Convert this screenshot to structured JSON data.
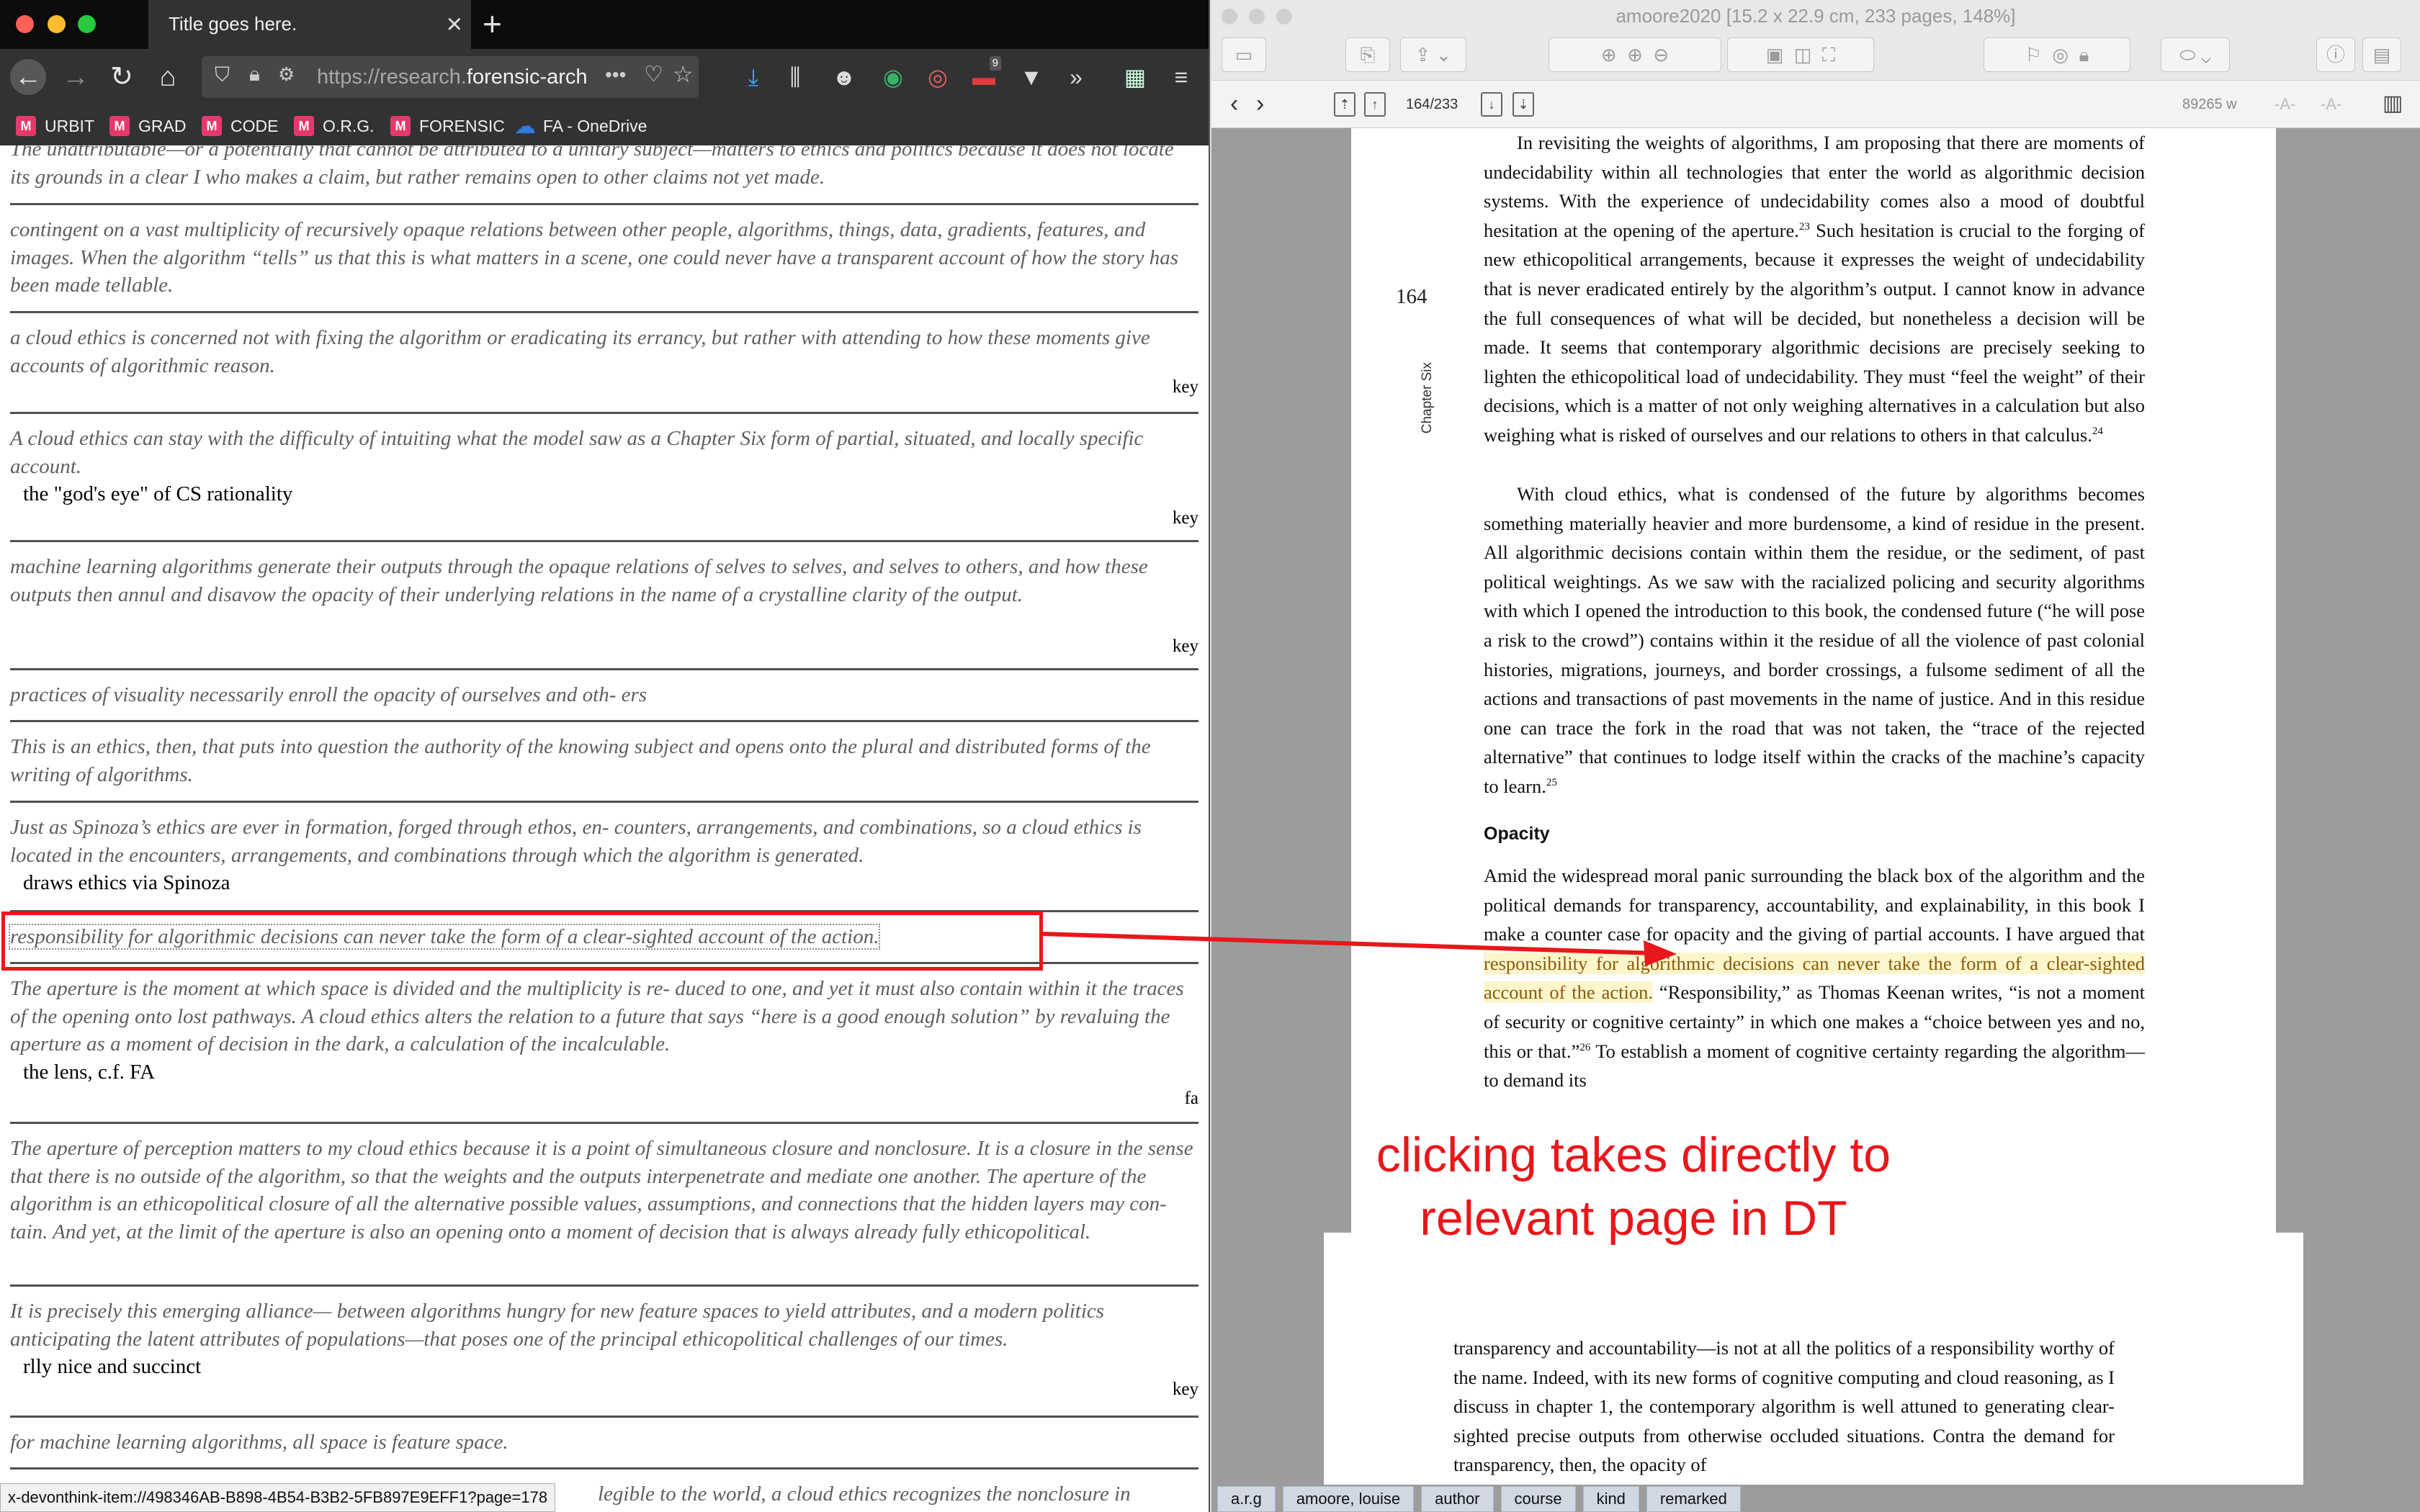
{
  "browser": {
    "tab_title": "Title goes here.",
    "url_prefix": "https://research.",
    "url_domain": "forensic-arch",
    "extensions_badge": "9",
    "bookmarks": [
      {
        "label": "URBIT"
      },
      {
        "label": "GRAD"
      },
      {
        "label": "CODE"
      },
      {
        "label": "O.R.G."
      },
      {
        "label": "FORENSIC"
      },
      {
        "label": "FA - OneDrive"
      }
    ],
    "entries": [
      {
        "quote": "The unattributable—or a potentially that cannot be attributed to a unitary subject—matters to ethics and politics because it does not locate its grounds in a clear I who makes a claim, but rather remains open to other claims not yet made.",
        "note": "",
        "tag": ""
      },
      {
        "quote": "contingent on a vast multiplicity of recursively opaque relations between other people, algorithms, things, data, gradients, features, and images. When the algorithm “tells” us that this is what matters in a scene, one could never have a transparent account of how the story has been made tellable.",
        "note": "",
        "tag": ""
      },
      {
        "quote": "a cloud ethics is concerned not with fixing the algorithm or eradicating its errancy, but rather with attending to how these moments give accounts of algorithmic reason.",
        "note": "",
        "tag": "key"
      },
      {
        "quote": "A cloud ethics can stay with the difficulty of intuiting what the model saw as a Chapter Six form of partial, situated, and locally specific account.",
        "note": "the \"god's eye\" of CS rationality",
        "tag": "key"
      },
      {
        "quote": "machine learning algorithms generate their outputs through the opaque relations of selves to selves, and selves to others, and how these outputs then annul and disavow the opacity of their underlying relations in the name of a crystalline clarity of the output.",
        "note": "",
        "tag": "key"
      },
      {
        "quote": "practices of visuality necessarily enroll the opacity of ourselves and oth- ers",
        "note": "",
        "tag": ""
      },
      {
        "quote": "This is an ethics, then, that puts into question the authority of the knowing subject and opens onto the plural and distributed forms of the writing of algorithms.",
        "note": "",
        "tag": ""
      },
      {
        "quote": "Just as Spinoza’s ethics are ever in formation, forged through ethos, en- counters, arrangements, and combinations, so a cloud ethics is located in the encounters, arrangements, and combinations through which the algorithm is generated.",
        "note": "draws ethics via Spinoza",
        "tag": ""
      },
      {
        "quote": "responsibility for algorithmic decisions can never take the form of a clear-sighted account of the action.",
        "note": "",
        "tag": ""
      },
      {
        "quote": "The aperture is the moment at which space is divided and the multiplicity is re- duced to one, and yet it must also contain within it the traces of the opening onto lost pathways. A cloud ethics alters the relation to a future that says “here is a good enough solution” by revaluing the aperture as a moment of decision in the dark, a calculation of the incalculable.",
        "note": "the lens, c.f. FA",
        "tag": "fa"
      },
      {
        "quote": "The aperture of perception matters to my cloud ethics because it is a point of simultaneous closure and nonclosure. It is a closure in the sense that there is no outside of the algorithm, so that the weights and the outputs interpenetrate and mediate one another. The aperture of the algorithm is an ethicopolitical closure of all the alternative possible values, assumptions, and connections that the hidden layers may con- tain. And yet, at the limit of the aperture is also an opening onto a moment of decision that is always already fully ethicopolitical.",
        "note": "",
        "tag": ""
      },
      {
        "quote": "It is precisely this emerging alliance— between algorithms hungry for new feature spaces to yield attributes, and a modern politics anticipating the latent attributes of populations—that poses one of the principal ethicopolitical challenges of our times.",
        "note": "rlly nice and succinct",
        "tag": "key"
      },
      {
        "quote": "for machine learning algorithms, all space is feature space.",
        "note": "",
        "tag": ""
      },
      {
        "quote": "legible to the world, a cloud ethics recognizes the nonclosure in",
        "note": "",
        "tag": ""
      }
    ],
    "status_url": "x-devonthink-item://498346AB-B898-4B54-B3B2-5FB897E9EFF1?page=178"
  },
  "pdf": {
    "window_title": "amoore2020 [15.2 x 22.9 cm, 233 pages, 148%]",
    "page_indicator": "164/233",
    "word_count": "89265 w",
    "page_number": "164",
    "chapter_label": "Chapter Six",
    "para1": "In revisiting the weights of algorithms, I am proposing that there are moments of undecidability within all technologies that enter the world as algorithmic decision systems. With the experience of undecidability comes also a mood of doubtful hesitation at the opening of the aperture.",
    "para1_fn": "23",
    "para1b": " Such hesitation is crucial to the forging of new ethicopolitical arrangements, because it expresses the weight of undecidability that is never eradicated entirely by the algorithm’s output. I cannot know in advance the full consequences of what will be decided, but nonetheless a decision will be made. It seems that contemporary algorithmic decisions are precisely seeking to lighten the ethicopolitical load of undecidability. They must “feel the weight” of their decisions, which is a matter of not only weighing alternatives in a calculation but also weighing what is risked of ourselves and our relations to others in that calculus.",
    "para1b_fn": "24",
    "para2": "With cloud ethics, what is condensed of the future by algorithms becomes something materially heavier and more burdensome, a kind of residue in the present. All algorithmic decisions contain within them the residue, or the sediment, of past political weightings. As we saw with the racialized policing and security algorithms with which I opened the introduction to this book, the condensed future (“he will pose a risk to the crowd”) contains within it the residue of all the violence of past colonial histories, migrations, journeys, and border crossings, a fulsome sediment of all the actions and transactions of past movements in the name of justice. And in this residue one can trace the fork in the road that was not taken, the “trace of the rejected alternative” that continues to lodge itself within the cracks of the machine’s capacity to learn.",
    "para2_fn": "25",
    "heading": "Opacity",
    "para3a": "Amid the widespread moral panic surrounding the black box of the algorithm and the political demands for transparency, accountability, and explainability, in this book I make a counter case for opacity and the giving of partial accounts. I have argued that ",
    "para3_hl": "responsibility for algorithmic decisions can never take the form of a clear-sighted account of the action.",
    "para3b": " “Responsibility,” as Thomas Keenan writes, “is not a moment of security or cognitive certainty” in which one makes a “choice between yes and no, this or that.”",
    "para3_fn": "26",
    "para3c": " To establish a moment of cognitive certainty regarding the algorithm—to demand its",
    "page2": "transparency and accountability—is not at all the politics of a responsibility worthy of the name. Indeed, with its new forms of cognitive computing and cloud reasoning, as I discuss in chapter 1, the contemporary algorithm is well attuned to generating clear-sighted precise outputs from otherwise occluded situations. Contra the demand for transparency, then, the opacity of",
    "tags": [
      "a.r.g",
      "amoore, louise",
      "author",
      "course",
      "kind",
      "remarked"
    ]
  },
  "annotation": {
    "line1": "clicking takes directly to",
    "line2": "relevant page in DT",
    "color": "#e8171b"
  }
}
